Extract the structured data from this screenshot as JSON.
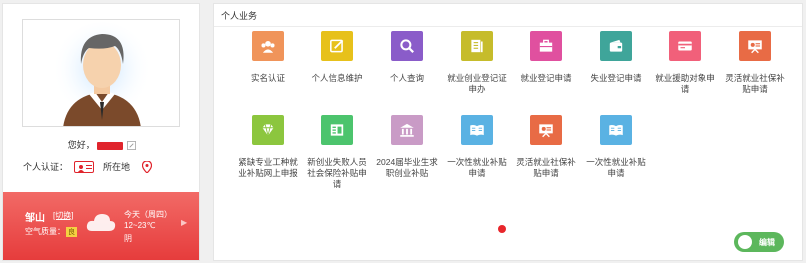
{
  "profile": {
    "greeting": "您好，",
    "verify_label": "个人认证：",
    "location_label": "所在地"
  },
  "weather": {
    "city": "邹山",
    "switch_label": "[切换]",
    "air_label": "空气质量：",
    "air_value": "良",
    "today": "今天（周四）",
    "temp": "12~23℃",
    "condition": "阴",
    "more": "▶"
  },
  "panel": {
    "title": "个人业务",
    "edit_label": "编辑"
  },
  "services": [
    {
      "label": "实名认证",
      "color": "#f0945a",
      "icon": "users-icon"
    },
    {
      "label": "个人信息维护",
      "color": "#e7c11b",
      "icon": "edit-icon"
    },
    {
      "label": "个人查询",
      "color": "#8a5cc9",
      "icon": "search-icon"
    },
    {
      "label": "就业创业登记证申办",
      "color": "#c6bc2b",
      "icon": "document-icon"
    },
    {
      "label": "就业登记申请",
      "color": "#e0509f",
      "icon": "briefcase-icon"
    },
    {
      "label": "失业登记申请",
      "color": "#3fa59a",
      "icon": "wallet-icon"
    },
    {
      "label": "就业援助对象申请",
      "color": "#f1607a",
      "icon": "card-icon"
    },
    {
      "label": "灵活就业社保补贴申请",
      "color": "#e86b45",
      "icon": "presentation-icon"
    },
    {
      "label": "紧缺专业工种就业补贴网上申报",
      "color": "#8cc63e",
      "icon": "diamond-icon"
    },
    {
      "label": "新创业失败人员社会保险补贴申请",
      "color": "#4cc46d",
      "icon": "sheet-icon"
    },
    {
      "label": "2024届毕业生求职创业补贴",
      "color": "#c99bc6",
      "icon": "bank-icon"
    },
    {
      "label": "一次性就业补贴申请",
      "color": "#5ab2e3",
      "icon": "book-icon"
    },
    {
      "label": "灵活就业社保补贴申请",
      "color": "#e86b45",
      "icon": "presentation-icon"
    },
    {
      "label": "一次性就业补贴申请",
      "color": "#5ab2e3",
      "icon": "book-icon"
    }
  ]
}
